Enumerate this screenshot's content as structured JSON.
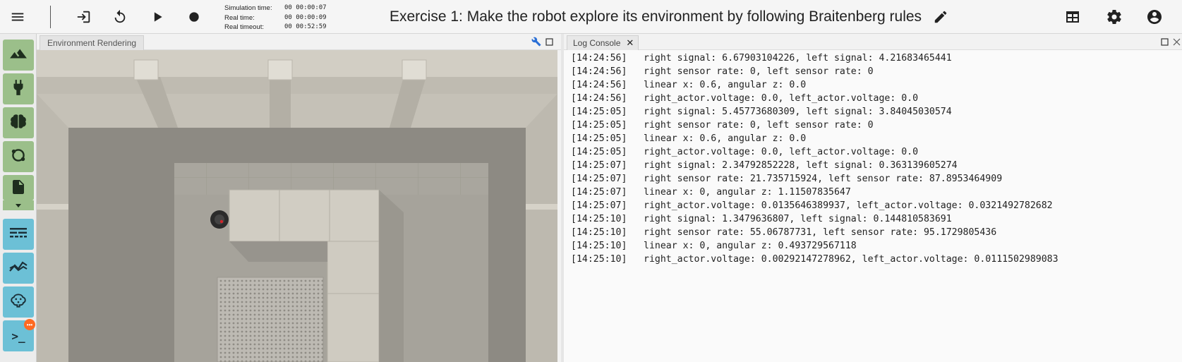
{
  "toolbar": {
    "icons": [
      "menu-icon",
      "exit-icon",
      "reset-icon",
      "play-icon",
      "record-icon"
    ],
    "sim_time_label": "Simulation time:",
    "sim_time_value": "00 00:00:07",
    "real_time_label": "Real time:",
    "real_time_value": "00 00:00:09",
    "real_timeout_label": "Real timeout:",
    "real_timeout_value": "00 00:52:59",
    "title": "Exercise 1: Make the robot explore its environment by following Braitenberg rules",
    "right_icons": [
      "layout-icon",
      "settings-icon",
      "account-icon"
    ]
  },
  "sidebar": {
    "buttons": [
      "environment-icon",
      "plug-icon",
      "brain-icon",
      "transfer-function-icon",
      "file-icon",
      "spike-train-icon",
      "plot-icon",
      "brain-visualizer-icon",
      "terminal-icon"
    ],
    "notification_badge": "•••"
  },
  "environment_panel": {
    "tab_label": "Environment Rendering"
  },
  "log_panel": {
    "tab_label": "Log Console",
    "lines": [
      {
        "ts": "[14:24:56]",
        "msg": "right signal: 6.67903104226, left signal: 4.21683465441"
      },
      {
        "ts": "[14:24:56]",
        "msg": "right sensor rate: 0, left sensor rate: 0"
      },
      {
        "ts": "[14:24:56]",
        "msg": "linear x: 0.6, angular z: 0.0"
      },
      {
        "ts": "[14:24:56]",
        "msg": "right_actor.voltage: 0.0, left_actor.voltage: 0.0"
      },
      {
        "ts": "[14:25:05]",
        "msg": "right signal: 5.45773680309, left signal: 3.84045030574"
      },
      {
        "ts": "[14:25:05]",
        "msg": "right sensor rate: 0, left sensor rate: 0"
      },
      {
        "ts": "[14:25:05]",
        "msg": "linear x: 0.6, angular z: 0.0"
      },
      {
        "ts": "[14:25:05]",
        "msg": "right_actor.voltage: 0.0, left_actor.voltage: 0.0"
      },
      {
        "ts": "[14:25:07]",
        "msg": "right signal: 2.34792852228, left signal: 0.363139605274"
      },
      {
        "ts": "[14:25:07]",
        "msg": "right sensor rate: 21.735715924, left sensor rate: 87.8953464909"
      },
      {
        "ts": "[14:25:07]",
        "msg": "linear x: 0, angular z: 1.11507835647"
      },
      {
        "ts": "[14:25:07]",
        "msg": "right_actor.voltage: 0.0135646389937, left_actor.voltage: 0.0321492782682"
      },
      {
        "ts": "[14:25:10]",
        "msg": "right signal: 1.3479636807, left signal: 0.144810583691"
      },
      {
        "ts": "[14:25:10]",
        "msg": "right sensor rate: 55.06787731, left sensor rate: 95.1729805436"
      },
      {
        "ts": "[14:25:10]",
        "msg": "linear x: 0, angular z: 0.493729567118"
      },
      {
        "ts": "[14:25:10]",
        "msg": "right_actor.voltage: 0.00292147278962, left_actor.voltage: 0.0111502989083"
      }
    ]
  },
  "colors": {
    "sidebar_green": "#9bbf8a",
    "sidebar_blue": "#6cc0d6",
    "notification": "#ff6a22",
    "wrench_blue": "#2a6fd6"
  }
}
